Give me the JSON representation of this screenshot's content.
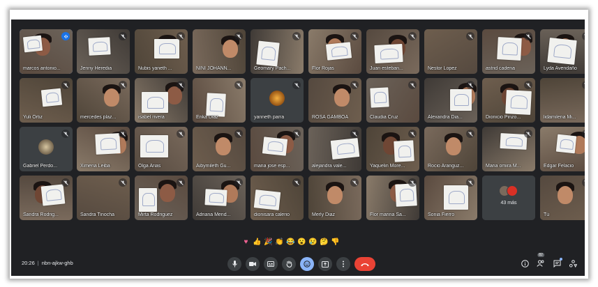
{
  "meeting": {
    "time": "20:26",
    "code": "nbn-ajkw-ghb",
    "participant_badge": "82",
    "more_label": "43 más"
  },
  "participants": [
    [
      "marcos antonio...",
      "Jenny Heredia",
      "Nubis yaneth ...",
      "NINI JOHANN...",
      "Geomary Pach...",
      "Flor Rojas",
      "Juan esteban...",
      "Nestor Lopez",
      "astrid cadena",
      "Lyda Avendaño"
    ],
    [
      "Yuli Ortiz",
      "mercedes plaz...",
      "isabel rivera",
      "Erika Diaz",
      "yanneth parra",
      "ROSA GAMBOA",
      "Claudia Cruz",
      "Alexandra Dia...",
      "Dionicio Pinzo...",
      "lidamilena Mi..."
    ],
    [
      "Gabriel Perdo...",
      "Ximena Leiba",
      "Olga Arias",
      "Aibymileth Gu...",
      "maria jose esp...",
      "alejandra vale...",
      "Yaquelin More...",
      "Rocio Aranguz...",
      "Maria omira M...",
      "Edgar Felacio"
    ],
    [
      "Sandra Rodrig...",
      "Sandra Tinocha",
      "Mirta Rodriguez",
      "Adriana Mend...",
      "dionisara calerio",
      "Merly Diaz",
      "Flor marina Sa...",
      "Sonia Fierro",
      "",
      "Tú"
    ]
  ],
  "reactions": [
    "heart",
    "thumbs-up",
    "party",
    "clap",
    "laugh",
    "surprised",
    "sad",
    "thinking",
    "thumbs-down"
  ],
  "colors": {
    "background": "#202124",
    "tile": "#3c4043",
    "accent": "#8ab4f8",
    "end_call": "#ea4335"
  }
}
